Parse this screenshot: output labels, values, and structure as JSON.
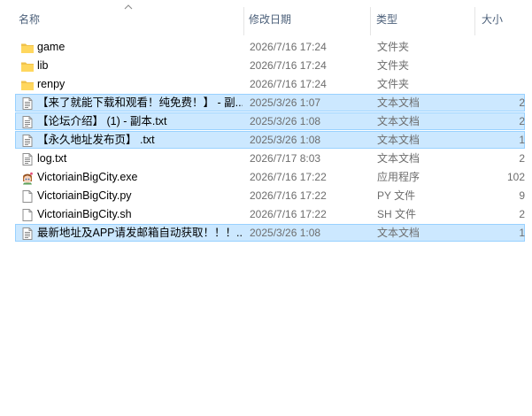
{
  "columns": {
    "name": "名称",
    "modified": "修改日期",
    "type": "类型",
    "size": "大小"
  },
  "files": [
    {
      "name": "game",
      "modified": "2026/7/16 17:24",
      "type": "文件夹",
      "size": "",
      "icon": "folder-icon",
      "selected": false
    },
    {
      "name": "lib",
      "modified": "2026/7/16 17:24",
      "type": "文件夹",
      "size": "",
      "icon": "folder-icon",
      "selected": false
    },
    {
      "name": "renpy",
      "modified": "2026/7/16 17:24",
      "type": "文件夹",
      "size": "",
      "icon": "folder-icon",
      "selected": false
    },
    {
      "name": "【来了就能下载和观看！纯免费！】 - 副...",
      "modified": "2025/3/26 1:07",
      "type": "文本文档",
      "size": "2",
      "icon": "text-file-icon",
      "selected": true
    },
    {
      "name": "【论坛介绍】 (1) - 副本.txt",
      "modified": "2025/3/26 1:08",
      "type": "文本文档",
      "size": "2",
      "icon": "text-file-icon",
      "selected": true
    },
    {
      "name": "【永久地址发布页】 .txt",
      "modified": "2025/3/26 1:08",
      "type": "文本文档",
      "size": "1",
      "icon": "text-file-icon",
      "selected": true
    },
    {
      "name": "log.txt",
      "modified": "2026/7/17 8:03",
      "type": "文本文档",
      "size": "2",
      "icon": "text-file-icon",
      "selected": false
    },
    {
      "name": "VictoriainBigCity.exe",
      "modified": "2026/7/16 17:22",
      "type": "应用程序",
      "size": "102",
      "icon": "app-icon",
      "selected": false
    },
    {
      "name": "VictoriainBigCity.py",
      "modified": "2026/7/16 17:22",
      "type": "PY 文件",
      "size": "9",
      "icon": "blank-file-icon",
      "selected": false
    },
    {
      "name": "VictoriainBigCity.sh",
      "modified": "2026/7/16 17:22",
      "type": "SH 文件",
      "size": "2",
      "icon": "blank-file-icon",
      "selected": false
    },
    {
      "name": "最新地址及APP请发邮箱自动获取！！！...",
      "modified": "2025/3/26 1:08",
      "type": "文本文档",
      "size": "1",
      "icon": "text-file-icon",
      "selected": true
    }
  ]
}
